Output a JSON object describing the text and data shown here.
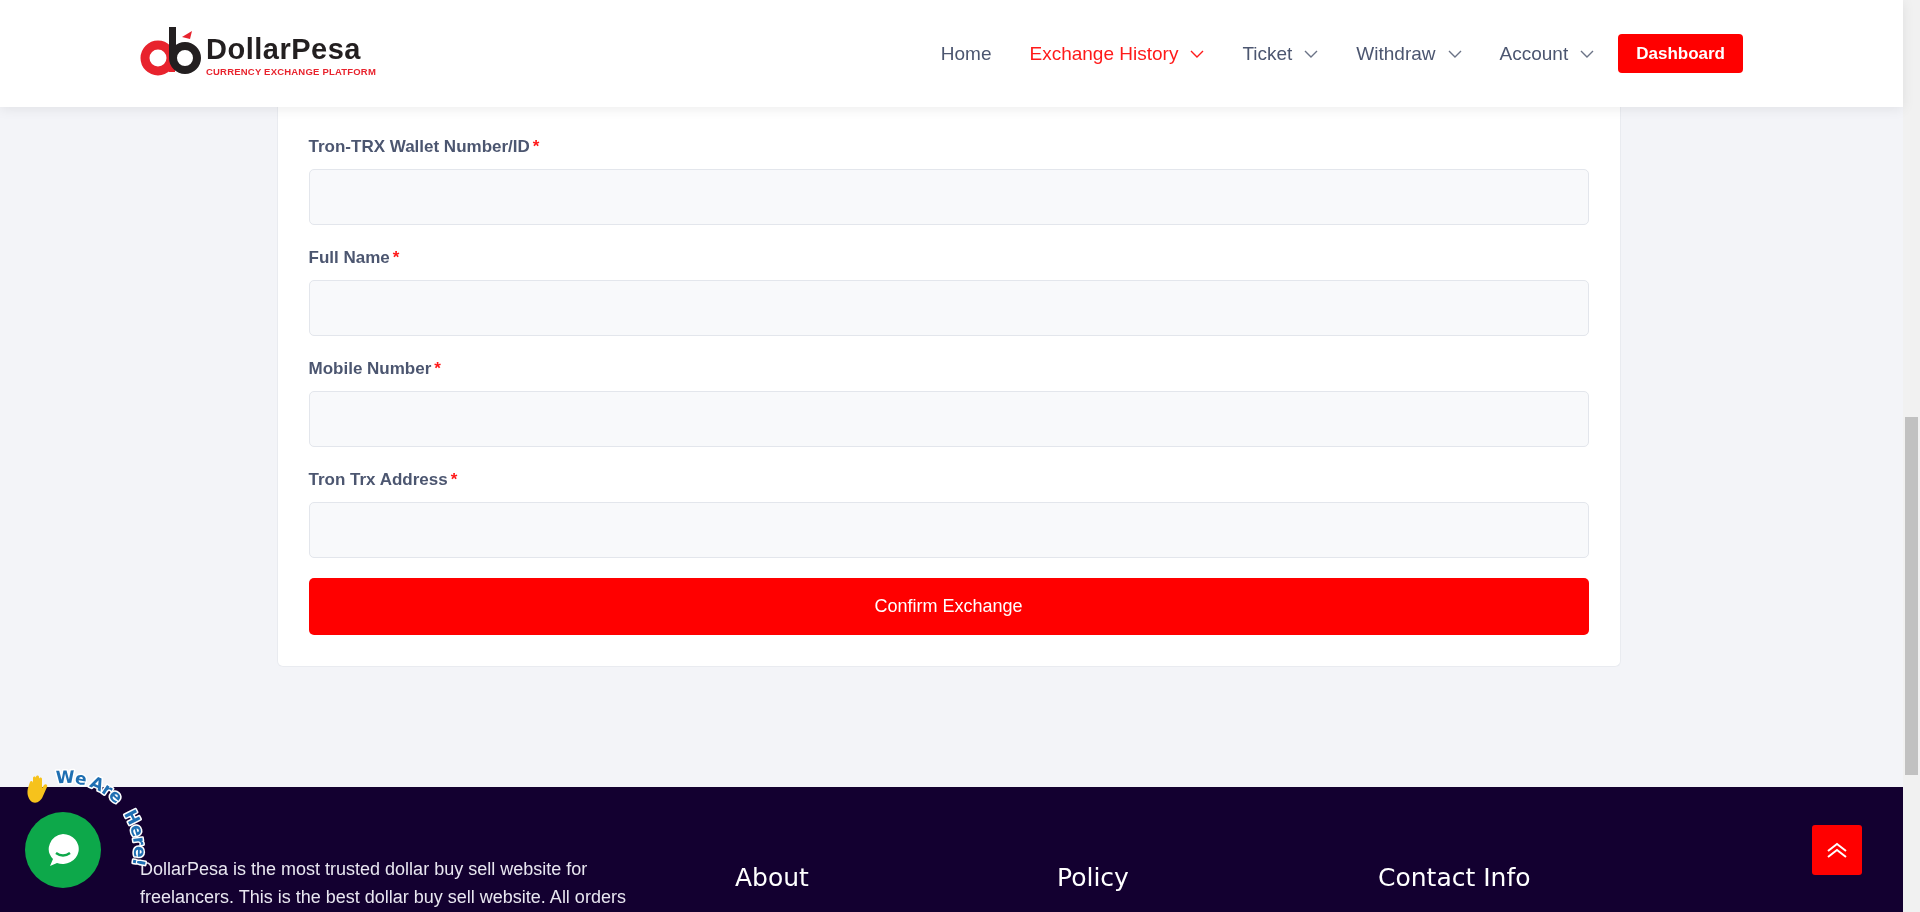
{
  "header": {
    "logo": {
      "name": "DollarPesa",
      "tagline": "CURRENCY EXCHANGE PLATFORM"
    },
    "nav": [
      {
        "label": "Home",
        "selected": false,
        "dropdown": false
      },
      {
        "label": "Exchange History",
        "selected": true,
        "dropdown": true
      },
      {
        "label": "Ticket",
        "selected": false,
        "dropdown": true
      },
      {
        "label": "Withdraw",
        "selected": false,
        "dropdown": true
      },
      {
        "label": "Account",
        "selected": false,
        "dropdown": true
      }
    ],
    "dashboard_button": "Dashboard"
  },
  "form": {
    "fields": [
      {
        "label": "Tron-TRX Wallet Number/ID",
        "required_mark": "*"
      },
      {
        "label": "Full Name",
        "required_mark": "*"
      },
      {
        "label": "Mobile Number",
        "required_mark": "*"
      },
      {
        "label": "Tron Trx Address",
        "required_mark": "*"
      }
    ],
    "submit": "Confirm Exchange"
  },
  "chat_widget": {
    "caption_words": [
      "We",
      "Are",
      "Here!"
    ]
  },
  "footer": {
    "about_text": "DollarPesa is the most trusted dollar buy sell website for freelancers. This is the best dollar buy sell website. All orders",
    "columns": [
      "About",
      "Policy",
      "Contact Info"
    ]
  }
}
